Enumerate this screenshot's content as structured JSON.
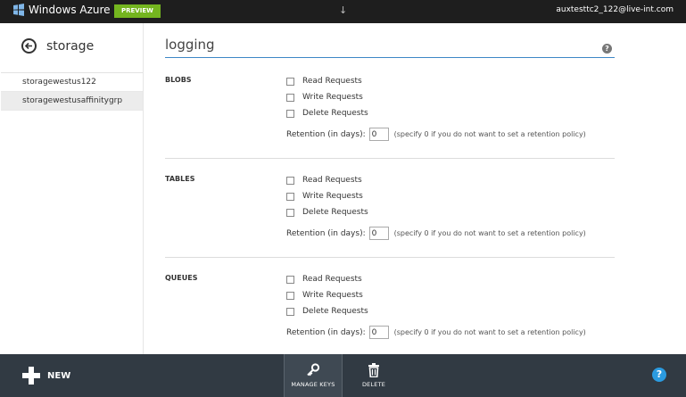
{
  "topbar": {
    "logo_text": "Windows Azure",
    "preview_label": "PREVIEW",
    "arrow": "↓",
    "user_email": "auxtesttc2_122@live-int.com"
  },
  "left_pane": {
    "title": "storage",
    "items": [
      {
        "label": "storagewestus122",
        "selected": false
      },
      {
        "label": "storagewestusaffinitygrp",
        "selected": true
      }
    ]
  },
  "main": {
    "title": "logging",
    "help": "?",
    "sections": [
      {
        "label": "BLOBS",
        "options": [
          "Read Requests",
          "Write Requests",
          "Delete Requests"
        ],
        "retention_label": "Retention (in days):",
        "retention_value": "0",
        "retention_hint": "(specify 0 if you do not want to set a retention policy)"
      },
      {
        "label": "TABLES",
        "options": [
          "Read Requests",
          "Write Requests",
          "Delete Requests"
        ],
        "retention_label": "Retention (in days):",
        "retention_value": "0",
        "retention_hint": "(specify 0 if you do not want to set a retention policy)"
      },
      {
        "label": "QUEUES",
        "options": [
          "Read Requests",
          "Write Requests",
          "Delete Requests"
        ],
        "retention_label": "Retention (in days):",
        "retention_value": "0",
        "retention_hint": "(specify 0 if you do not want to set a retention policy)"
      }
    ]
  },
  "bottombar": {
    "new_label": "NEW",
    "manage_keys_label": "MANAGE KEYS",
    "delete_label": "DELETE",
    "help": "?"
  },
  "colors": {
    "topbar": "#1e1e1e",
    "preview_badge": "#74b51f",
    "title_underline": "#3d87c6",
    "bottombar": "#313a43",
    "help_button": "#2b9be0"
  }
}
